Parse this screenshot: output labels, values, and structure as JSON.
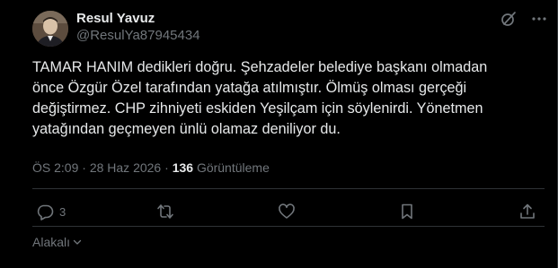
{
  "tweet": {
    "author": {
      "display_name": "Resul Yavuz",
      "handle": "@ResulYa87945434",
      "avatar_icon": "profile-photo"
    },
    "text": "TAMAR HANIM dedikleri doğru. Şehzadeler belediye başkanı olmadan\nönce Özgür Özel tarafından yatağa atılmıştır. Ölmüş olması gerçeği\ndeğiştirmez. CHP zihniyeti eskiden Yeşilçam için söylenirdi. Yönetmen\nyatağından geçmeyen ünlü olamaz deniliyor du.",
    "meta": {
      "time": "ÖS 2:09",
      "separator": "·",
      "date": "28 Haz 2026",
      "views_count": "136",
      "views_label": "Görüntüleme"
    },
    "actions": {
      "reply_count": "3",
      "retweet_count": "",
      "like_count": "",
      "bookmark_count": ""
    },
    "footer": {
      "related_label": "Alakalı"
    }
  },
  "colors": {
    "background": "#000000",
    "primary_text": "#e7e9ea",
    "secondary_text": "#71767b",
    "border": "#2f3336"
  }
}
